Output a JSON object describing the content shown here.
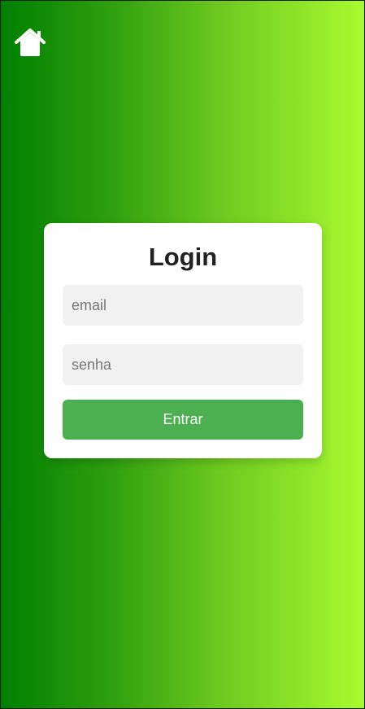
{
  "home": {
    "icon": "home-icon"
  },
  "login": {
    "title": "Login",
    "email_placeholder": "email",
    "email_value": "",
    "password_placeholder": "senha",
    "password_value": "",
    "submit_label": "Entrar"
  },
  "colors": {
    "gradient_start": "#008000",
    "gradient_end": "#a8fb2f",
    "button": "#4caf50",
    "field_bg": "#f1f1f1",
    "card_bg": "#ffffff"
  }
}
